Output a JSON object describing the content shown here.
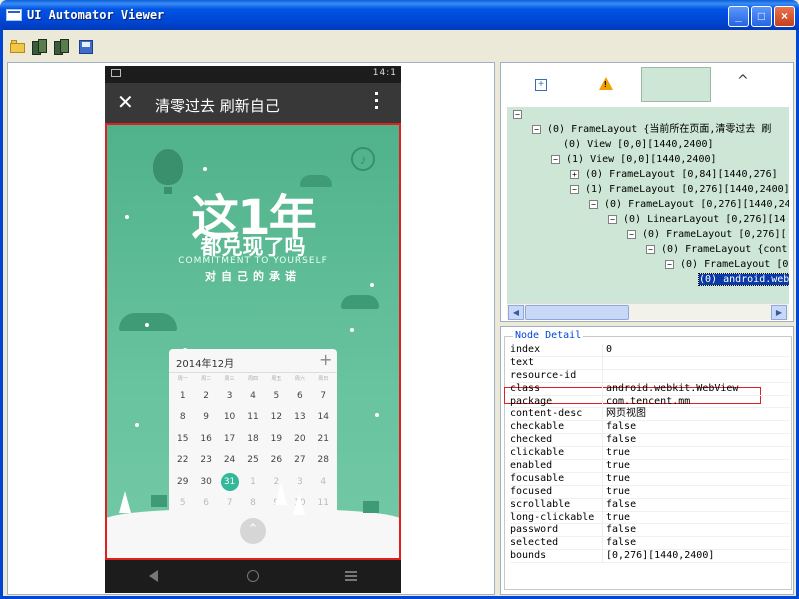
{
  "window": {
    "title": "UI Automator Viewer"
  },
  "phone": {
    "status_time": "14:1",
    "appbar_title": "清零过去 刷新自己",
    "headline1": "这1年",
    "headline2": "都兑现了吗",
    "headline3": "COMMITMENT TO YOURSELF",
    "headline4": "对自己的承诺",
    "calendar": {
      "month": "2014年12月",
      "add": "+",
      "weekdays": [
        "周一",
        "周二",
        "周三",
        "周四",
        "周五",
        "周六",
        "周日"
      ],
      "rows": [
        [
          "1",
          "2",
          "3",
          "4",
          "5",
          "6",
          "7"
        ],
        [
          "8",
          "9",
          "10",
          "11",
          "12",
          "13",
          "14"
        ],
        [
          "15",
          "16",
          "17",
          "18",
          "19",
          "20",
          "21"
        ],
        [
          "22",
          "23",
          "24",
          "25",
          "26",
          "27",
          "28"
        ],
        [
          "29",
          "30",
          "31",
          "1",
          "2",
          "3",
          "4"
        ],
        [
          "5",
          "6",
          "7",
          "8",
          "9",
          "10",
          "11"
        ]
      ]
    }
  },
  "hierarchy": {
    "nodes": [
      {
        "text": "(0) FrameLayout {当前所在页面,清零过去 刷",
        "box": "−"
      },
      {
        "text": "(0) View [0,0][1440,2400]",
        "box": ""
      },
      {
        "text": "(1) View [0,0][1440,2400]",
        "box": "−"
      },
      {
        "text": "(0) FrameLayout [0,84][1440,276]",
        "box": "+"
      },
      {
        "text": "(1) FrameLayout [0,276][1440,2400]",
        "box": "−"
      },
      {
        "text": "(0) FrameLayout [0,276][1440,24",
        "box": "−"
      },
      {
        "text": "(0) LinearLayout [0,276][14",
        "box": "−"
      },
      {
        "text": "(0) FrameLayout [0,276][",
        "box": "−"
      },
      {
        "text": "(0) FrameLayout {cont",
        "box": "−"
      },
      {
        "text": "(0) FrameLayout [0",
        "box": "−"
      },
      {
        "text": "(0) android.web",
        "box": ""
      }
    ]
  },
  "node_detail": {
    "legend": "Node Detail",
    "rows": [
      {
        "key": "index",
        "value": "0"
      },
      {
        "key": "text",
        "value": ""
      },
      {
        "key": "resource-id",
        "value": ""
      },
      {
        "key": "class",
        "value": "android.webkit.WebView"
      },
      {
        "key": "package",
        "value": "com.tencent.mm"
      },
      {
        "key": "content-desc",
        "value": "网页视图"
      },
      {
        "key": "checkable",
        "value": "false"
      },
      {
        "key": "checked",
        "value": "false"
      },
      {
        "key": "clickable",
        "value": "true"
      },
      {
        "key": "enabled",
        "value": "true"
      },
      {
        "key": "focusable",
        "value": "true"
      },
      {
        "key": "focused",
        "value": "true"
      },
      {
        "key": "scrollable",
        "value": "false"
      },
      {
        "key": "long-clickable",
        "value": "true"
      },
      {
        "key": "password",
        "value": "false"
      },
      {
        "key": "selected",
        "value": "false"
      },
      {
        "key": "bounds",
        "value": "[0,276][1440,2400]"
      }
    ]
  }
}
